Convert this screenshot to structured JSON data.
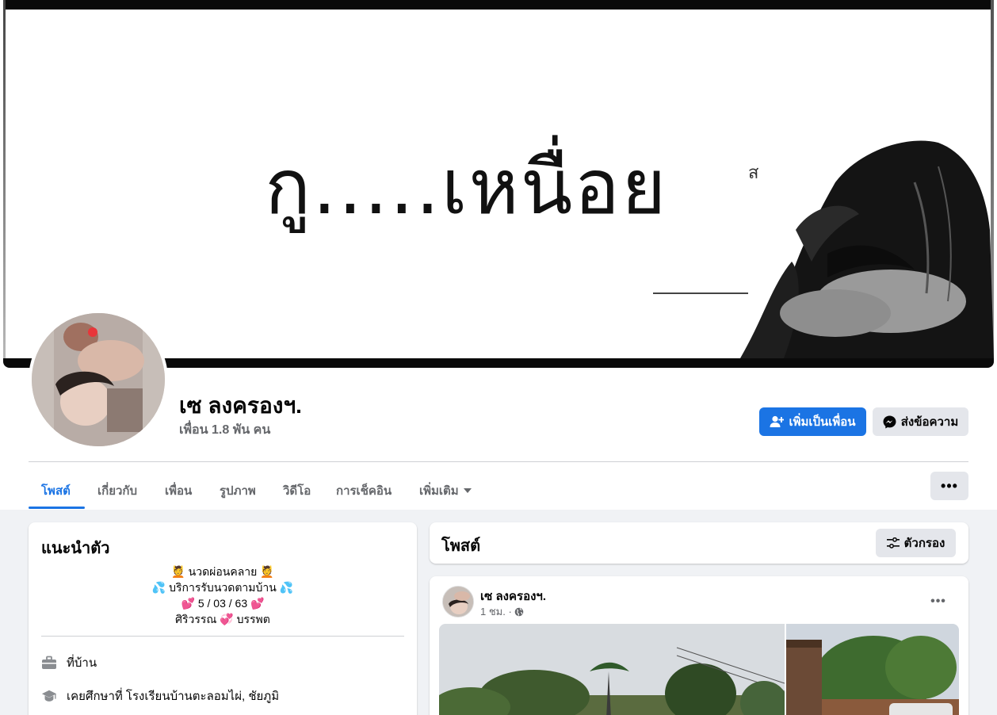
{
  "cover": {
    "main_text": "กู.....เหนื่อย",
    "side_text": "ส"
  },
  "profile": {
    "name": "เซ ลงครองฯ.",
    "friends": "เพื่อน 1.8 พัน คน"
  },
  "actions": {
    "add_friend": "เพิ่มเป็นเพื่อน",
    "message": "ส่งข้อความ"
  },
  "tabs": [
    {
      "label": "โพสต์",
      "active": true
    },
    {
      "label": "เกี่ยวกับ",
      "active": false
    },
    {
      "label": "เพื่อน",
      "active": false
    },
    {
      "label": "รูปภาพ",
      "active": false
    },
    {
      "label": "วิดีโอ",
      "active": false
    },
    {
      "label": "การเช็คอิน",
      "active": false
    },
    {
      "label": "เพิ่มเติม",
      "active": false
    }
  ],
  "more_menu_label": "•••",
  "intro": {
    "title": "แนะนำตัว",
    "bio": [
      "💆 นวดผ่อนคลาย 💆",
      "💦 บริการรับนวดตามบ้าน 💦",
      "💕 5 / 03 / 63 💕",
      "ศิริวรรณ 💞 บรรพต"
    ],
    "workplace": "ที่บ้าน",
    "education": "เคยศึกษาที่ โรงเรียนบ้านตะลอมไผ่, ชัยภูมิ"
  },
  "posts": {
    "title": "โพสต์",
    "filter_label": "ตัวกรอง"
  },
  "post": {
    "author": "เซ ลงครองฯ.",
    "time": "1 ชม. ·",
    "more": "•••"
  },
  "colors": {
    "accent": "#1b74e4",
    "background": "#f0f2f5",
    "secondary_button": "#e4e6eb",
    "muted_text": "#65676b"
  }
}
